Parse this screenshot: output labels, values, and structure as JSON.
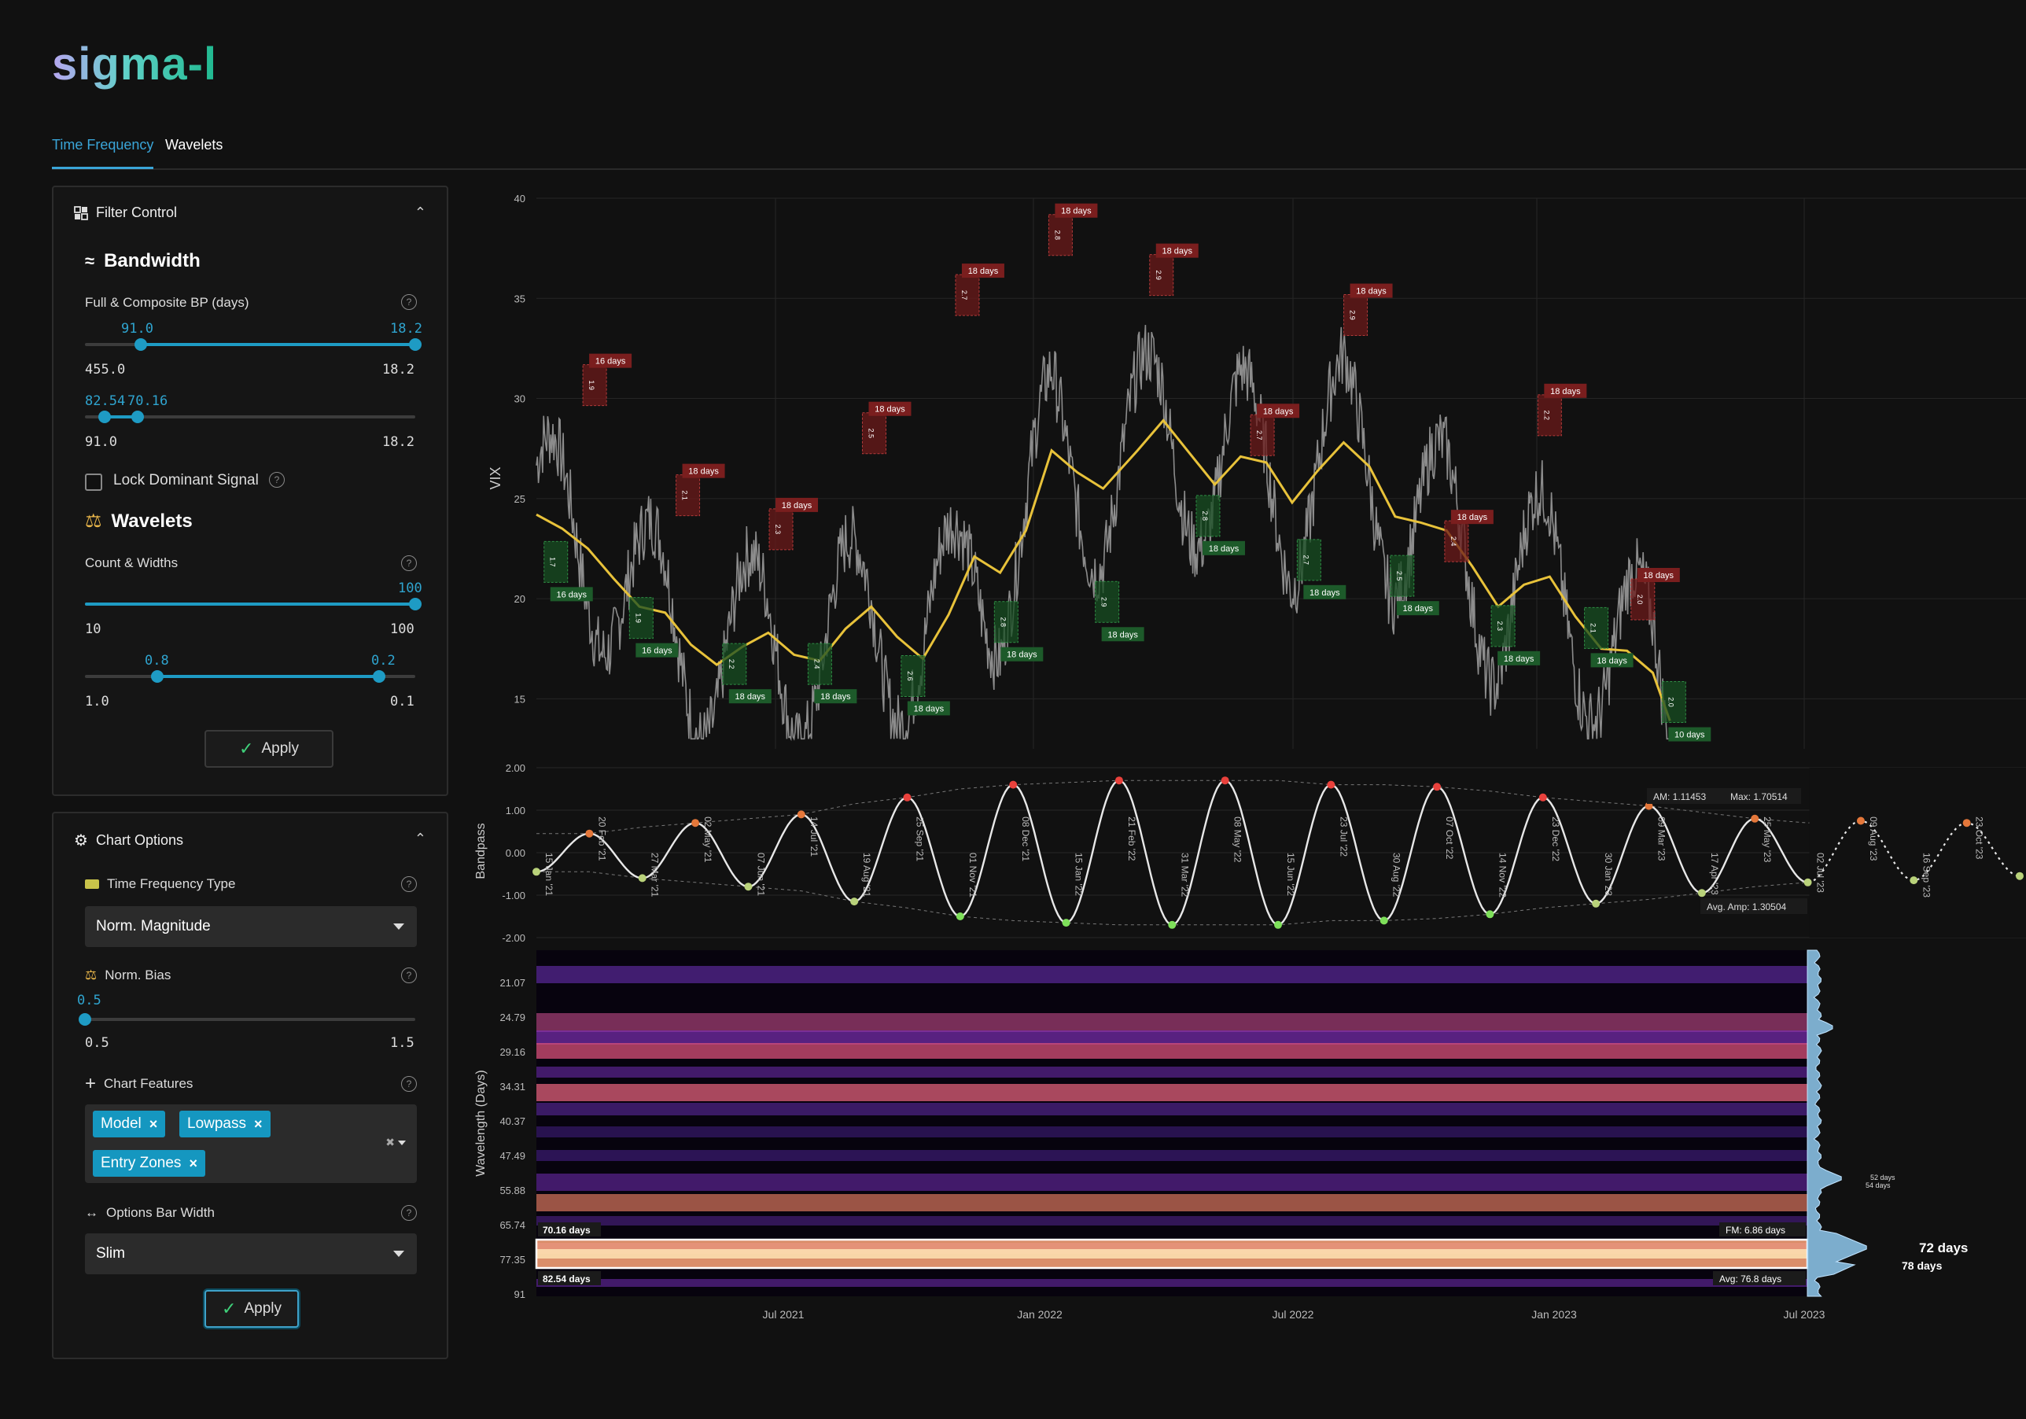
{
  "app": {
    "logo": "sigma-l"
  },
  "tabs": [
    {
      "label": "Time Frequency",
      "active": true
    },
    {
      "label": "Wavelets",
      "active": false
    }
  ],
  "filter_control": {
    "title": "Filter Control",
    "bandwidth": {
      "heading": "Bandwidth",
      "label": "Full & Composite BP (days)",
      "slider1": {
        "left_value": "91.0",
        "right_value": "18.2",
        "min_label": "455.0",
        "max_label": "18.2",
        "low_frac": 0.17,
        "high_frac": 1.0
      },
      "slider2": {
        "left_value": "82.54",
        "right_value": "70.16",
        "min_label": "91.0",
        "max_label": "18.2",
        "low_frac": 0.06,
        "high_frac": 0.16
      },
      "lock_label": "Lock Dominant Signal"
    },
    "wavelets": {
      "heading": "Wavelets",
      "label": "Count & Widths",
      "slider1": {
        "value": "100",
        "min_label": "10",
        "max_label": "100",
        "frac": 1.0
      },
      "slider2": {
        "left_value": "0.8",
        "right_value": "0.2",
        "min_label": "1.0",
        "max_label": "0.1",
        "low_frac": 0.22,
        "high_frac": 0.89
      }
    },
    "apply": "Apply"
  },
  "chart_options": {
    "title": "Chart Options",
    "tf_type_label": "Time Frequency Type",
    "tf_type_value": "Norm. Magnitude",
    "norm_bias_label": "Norm. Bias",
    "norm_bias": {
      "value": "0.5",
      "min_label": "0.5",
      "max_label": "1.5",
      "frac": 0.0
    },
    "features_label": "Chart Features",
    "features": [
      "Model",
      "Lowpass",
      "Entry Zones"
    ],
    "bar_width_label": "Options Bar Width",
    "bar_width_value": "Slim",
    "apply": "Apply"
  },
  "chart_data": [
    {
      "type": "line",
      "ylabel": "VIX",
      "yticks": [
        15,
        20,
        25,
        30,
        35,
        40
      ],
      "ylim": [
        12.5,
        40
      ],
      "lowpass_points": [
        [
          0,
          24.2
        ],
        [
          3,
          23.5
        ],
        [
          6,
          22.5
        ],
        [
          9,
          21
        ],
        [
          12,
          19.6
        ],
        [
          15,
          19.3
        ],
        [
          18,
          17.7
        ],
        [
          21,
          16.7
        ],
        [
          24,
          17.6
        ],
        [
          27,
          18.3
        ],
        [
          30,
          17.2
        ],
        [
          33,
          16.9
        ],
        [
          36,
          18.5
        ],
        [
          39,
          19.6
        ],
        [
          42,
          18.1
        ],
        [
          45,
          17.0
        ],
        [
          48,
          19.2
        ],
        [
          51,
          22.1
        ],
        [
          54,
          21.3
        ],
        [
          57,
          23.4
        ],
        [
          60,
          27.4
        ],
        [
          63,
          26.3
        ],
        [
          66,
          25.5
        ],
        [
          70,
          27.4
        ],
        [
          73,
          28.9
        ],
        [
          76,
          27.3
        ],
        [
          79,
          25.7
        ],
        [
          82,
          27.1
        ],
        [
          85,
          26.8
        ],
        [
          88,
          24.8
        ],
        [
          91,
          26.4
        ],
        [
          94,
          27.8
        ],
        [
          97,
          26.6
        ],
        [
          100,
          24.1
        ],
        [
          103,
          23.8
        ],
        [
          106,
          23.4
        ],
        [
          109,
          21.6
        ],
        [
          112,
          19.6
        ],
        [
          115,
          20.7
        ],
        [
          118,
          21.1
        ],
        [
          121,
          19.1
        ],
        [
          124,
          17.5
        ],
        [
          127,
          17.4
        ],
        [
          130,
          16.3
        ],
        [
          132,
          13.9
        ]
      ],
      "peak_labels": [
        {
          "x": 7,
          "y": 32,
          "label": "16 days",
          "code": "1.9"
        },
        {
          "x": 19,
          "y": 26.5,
          "label": "18 days",
          "code": "2.1"
        },
        {
          "x": 31,
          "y": 24.8,
          "label": "18 days",
          "code": "2.3"
        },
        {
          "x": 43,
          "y": 29.6,
          "label": "18 days",
          "code": "2.5"
        },
        {
          "x": 55,
          "y": 36.5,
          "label": "18 days",
          "code": "2.7"
        },
        {
          "x": 67,
          "y": 39.5,
          "label": "18 days",
          "code": "2.8"
        },
        {
          "x": 80,
          "y": 37.5,
          "label": "18 days",
          "code": "2.9"
        },
        {
          "x": 93,
          "y": 29.5,
          "label": "18 days",
          "code": "2.7"
        },
        {
          "x": 105,
          "y": 35.5,
          "label": "18 days",
          "code": "2.9"
        },
        {
          "x": 118,
          "y": 24.2,
          "label": "18 days",
          "code": "2.4"
        },
        {
          "x": 130,
          "y": 30.5,
          "label": "18 days",
          "code": "2.2"
        },
        {
          "x": 142,
          "y": 21.3,
          "label": "18 days",
          "code": "2.0"
        }
      ],
      "trough_labels": [
        {
          "x": 2,
          "y": 20.5,
          "label": "16 days",
          "code": "1.7"
        },
        {
          "x": 13,
          "y": 17.7,
          "label": "16 days",
          "code": "1.9"
        },
        {
          "x": 25,
          "y": 15.4,
          "label": "18 days",
          "code": "2.2"
        },
        {
          "x": 36,
          "y": 15.4,
          "label": "18 days",
          "code": "2.4"
        },
        {
          "x": 48,
          "y": 14.8,
          "label": "18 days",
          "code": "2.6"
        },
        {
          "x": 60,
          "y": 17.5,
          "label": "18 days",
          "code": "2.8"
        },
        {
          "x": 73,
          "y": 18.5,
          "label": "18 days",
          "code": "2.9"
        },
        {
          "x": 86,
          "y": 22.8,
          "label": "18 days",
          "code": "2.8"
        },
        {
          "x": 99,
          "y": 20.6,
          "label": "18 days",
          "code": "2.7"
        },
        {
          "x": 111,
          "y": 19.8,
          "label": "18 days",
          "code": "2.5"
        },
        {
          "x": 124,
          "y": 17.3,
          "label": "18 days",
          "code": "2.3"
        },
        {
          "x": 136,
          "y": 17.2,
          "label": "18 days",
          "code": "2.1"
        },
        {
          "x": 146,
          "y": 13.5,
          "label": "10 days",
          "code": "2.0"
        }
      ]
    },
    {
      "type": "line",
      "ylabel": "Bandpass",
      "yticks": [
        "2.00",
        "1.00",
        "0.00",
        "-1.00",
        "-2.00"
      ],
      "ylim": [
        -2,
        2
      ],
      "dates": [
        "15 Jan '21",
        "20 Feb '21",
        "27 Mar '21",
        "02 May '21",
        "07 Jun '21",
        "14 Jul '21",
        "19 Aug '21",
        "25 Sep '21",
        "01 Nov '21",
        "08 Dec '21",
        "15 Jan '22",
        "21 Feb '22",
        "31 Mar '22",
        "08 May '22",
        "15 Jun '22",
        "23 Jul '22",
        "30 Aug '22",
        "07 Oct '22",
        "14 Nov '22",
        "23 Dec '22",
        "30 Jan '23",
        "09 Mar '23",
        "17 Apr '23",
        "25 May '23",
        "02 Jul '23",
        "09 Aug '23",
        "16 Sep '23",
        "23 Oct '23",
        "30 Nov '23"
      ],
      "extrema_values": [
        -0.45,
        0.45,
        -0.6,
        0.7,
        -0.8,
        0.9,
        -1.15,
        1.3,
        -1.5,
        1.6,
        -1.65,
        1.7,
        -1.7,
        1.7,
        -1.7,
        1.6,
        -1.6,
        1.55,
        -1.45,
        1.3,
        -1.2,
        1.1,
        -0.95,
        0.8,
        -0.7,
        0.75,
        -0.65,
        0.7,
        -0.55
      ],
      "annotations": {
        "am": "AM: 1.11453",
        "max": "Max: 1.70514",
        "avg_amp": "Avg. Amp: 1.30504"
      }
    },
    {
      "type": "heatmap",
      "ylabel": "Wavelength (Days)",
      "yticks": [
        "21.07",
        "24.79",
        "29.16",
        "34.31",
        "40.37",
        "47.49",
        "55.88",
        "65.74",
        "77.35",
        "91"
      ],
      "xticks": [
        "Jul 2021",
        "Jan 2022",
        "Jul 2022",
        "Jan 2023",
        "Jul 2023"
      ],
      "band_labels": {
        "top": "70.16 days",
        "bottom": "82.54 days",
        "fm": "FM: 6.86 days",
        "avg": "Avg: 76.8 days"
      },
      "spectrum_peaks": [
        {
          "label": "72 days",
          "rank": "primary"
        },
        {
          "label": "78 days",
          "rank": "secondary"
        },
        {
          "label": "52 days",
          "rank": "minor"
        },
        {
          "label": "54 days",
          "rank": "minor"
        }
      ]
    }
  ]
}
